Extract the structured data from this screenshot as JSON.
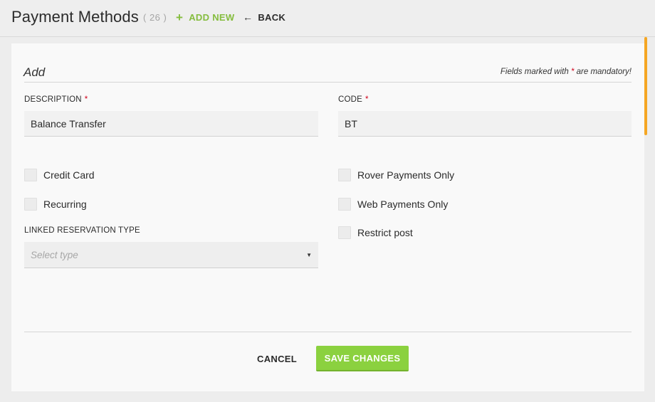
{
  "header": {
    "title": "Payment Methods",
    "count": "( 26 )",
    "add_new_icon": "plus-icon",
    "add_new_label": "ADD NEW",
    "back_icon": "arrow-left-icon",
    "back_label": "BACK"
  },
  "form": {
    "heading": "Add",
    "mandatory_note_prefix": "Fields marked with",
    "mandatory_star": "*",
    "mandatory_note_suffix": "are mandatory!",
    "description": {
      "label": "DESCRIPTION",
      "required": "*",
      "value": "Balance Transfer"
    },
    "code": {
      "label": "CODE",
      "required": "*",
      "value": "BT"
    },
    "checkboxes_left": [
      {
        "label": "Credit Card",
        "checked": false
      },
      {
        "label": "Recurring",
        "checked": false
      }
    ],
    "checkboxes_right": [
      {
        "label": "Rover Payments Only",
        "checked": false
      },
      {
        "label": "Web Payments Only",
        "checked": false
      },
      {
        "label": "Restrict post",
        "checked": false
      }
    ],
    "linked_reservation": {
      "label": "LINKED RESERVATION TYPE",
      "placeholder": "Select type",
      "caret_icon": "caret-down-icon"
    },
    "cancel_label": "CANCEL",
    "save_label": "SAVE CHANGES"
  },
  "colors": {
    "accent_green": "#85bd3e",
    "save_button": "#8bd13f",
    "required_star": "#d0021b",
    "scroll_indicator": "#f5a623"
  }
}
